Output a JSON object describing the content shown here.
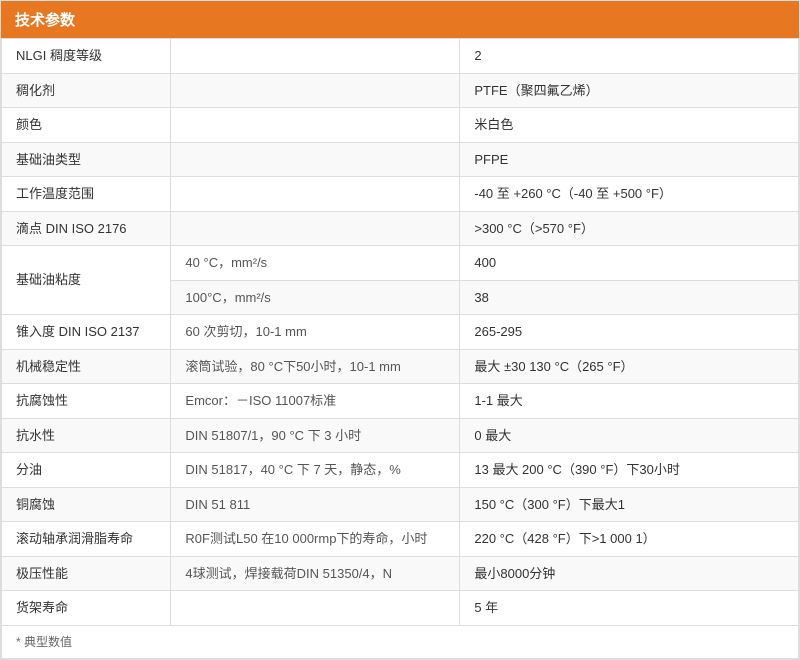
{
  "header": {
    "title": "技术参数"
  },
  "rows": [
    {
      "label": "NLGI 稠度等级",
      "detail": "",
      "value": "2"
    },
    {
      "label": "稠化剂",
      "detail": "",
      "value": "PTFE（聚四氟乙烯）"
    },
    {
      "label": "颜色",
      "detail": "",
      "value": "米白色"
    },
    {
      "label": "基础油类型",
      "detail": "",
      "value": "PFPE"
    },
    {
      "label": "工作温度范围",
      "detail": "",
      "value": "-40 至 +260 °C（-40 至 +500 °F）"
    },
    {
      "label": "滴点 DIN ISO 2176",
      "detail": "",
      "value": ">300 °C（>570 °F）"
    },
    {
      "label": "基础油粘度",
      "detail": "40 °C，mm²/s",
      "value": "400"
    },
    {
      "label": "",
      "detail": "100°C，mm²/s",
      "value": "38"
    },
    {
      "label": "锥入度 DIN ISO 2137",
      "detail": "60 次剪切，10-1 mm",
      "value": "265-295"
    },
    {
      "label": "机械稳定性",
      "detail": "滚筒试验，80 °C下50小时，10-1 mm",
      "value": "最大 ±30 130 °C（265 °F）"
    },
    {
      "label": "抗腐蚀性",
      "detail": "Emcor：－ISO 11007标准",
      "value": "1-1 最大"
    },
    {
      "label": "抗水性",
      "detail": "DIN 51807/1，90 °C 下 3 小时",
      "value": "0 最大"
    },
    {
      "label": "分油",
      "detail": "DIN 51817，40 °C 下 7 天，静态，%",
      "value": "13 最大 200 °C（390 °F）下30小时"
    },
    {
      "label": "铜腐蚀",
      "detail": "DIN 51 811",
      "value": "150 °C（300 °F）下最大1"
    },
    {
      "label": "滚动轴承润滑脂寿命",
      "detail": "R0F测试L50 在10 000rmp下的寿命，小时",
      "value": "220 °C（428 °F）下>1 000 1）"
    },
    {
      "label": "极压性能",
      "detail": "4球测试，焊接载荷DIN 51350/4，N",
      "value": "最小8000分钟"
    },
    {
      "label": "货架寿命",
      "detail": "",
      "value": "5 年"
    }
  ],
  "footer": "* 典型数值"
}
